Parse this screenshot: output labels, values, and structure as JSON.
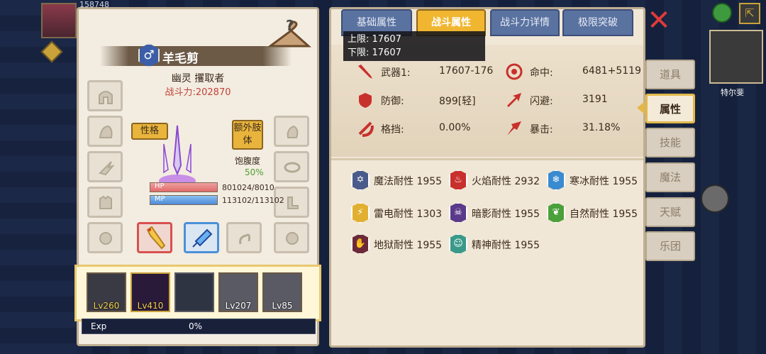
{
  "hud": {
    "top_value": "158748"
  },
  "pet": {
    "gender_symbol": "♂",
    "name": "羊毛剪",
    "title": "幽灵 攫取者",
    "power": "战斗力:202870",
    "tag_personality": "性格",
    "tag_extra_limb": "额外肢体",
    "satiety_label": "饱腹度",
    "satiety_value": "50%",
    "hp_label": "HP",
    "hp_value": "801024/8010",
    "hp_fill": 1.0,
    "mp_label": "MP",
    "mp_value": "113102/113102",
    "mp_fill": 1.0
  },
  "team": [
    {
      "level": "Lv260"
    },
    {
      "level": "Lv410"
    },
    {
      "level": ""
    },
    {
      "level": "Lv207"
    },
    {
      "level": "Lv85"
    }
  ],
  "exp": {
    "label": "Exp",
    "value": "0%",
    "fill": 0
  },
  "tabs": [
    {
      "label": "基础属性"
    },
    {
      "label": "战斗属性"
    },
    {
      "label": "战斗力详情"
    },
    {
      "label": "极限突破"
    }
  ],
  "tooltip": {
    "line1": "上限: 17607",
    "line2": "下限: 17607"
  },
  "stats": {
    "weapon_label": "武器1:",
    "weapon_value": "17607-176",
    "hit_label": "命中:",
    "hit_value": "6481+5119",
    "defense_label": "防御:",
    "defense_value": "899[轻]",
    "dodge_label": "闪避:",
    "dodge_value": "3191",
    "block_label": "格挡:",
    "block_value": "0.00%",
    "crit_label": "暴击:",
    "crit_value": "31.18%"
  },
  "resistances": [
    {
      "label": "魔法耐性 1955",
      "color": "#4a5a8a",
      "symbol": "✡"
    },
    {
      "label": "火焰耐性 2932",
      "color": "#c8302c",
      "symbol": "♨"
    },
    {
      "label": "寒冰耐性 1955",
      "color": "#3a8ad0",
      "symbol": "❄"
    },
    {
      "label": "雷电耐性 1303",
      "color": "#e2b030",
      "symbol": "⚡"
    },
    {
      "label": "暗影耐性 1955",
      "color": "#5a3a8a",
      "symbol": "☠"
    },
    {
      "label": "自然耐性 1955",
      "color": "#4aa03a",
      "symbol": "❦"
    },
    {
      "label": "地狱耐性 1955",
      "color": "#6a2a3a",
      "symbol": "✋"
    },
    {
      "label": "精神耐性 1955",
      "color": "#3a9a8a",
      "symbol": "☺"
    }
  ],
  "side_nav": [
    {
      "label": "道具"
    },
    {
      "label": "属性"
    },
    {
      "label": "技能"
    },
    {
      "label": "魔法"
    },
    {
      "label": "天赋"
    },
    {
      "label": "乐团"
    }
  ],
  "minimap": {
    "label": "特尔斐"
  },
  "colors": {
    "accent": "#f0b630",
    "tab_blue": "#5a72a0",
    "panel": "#f1e7d6"
  }
}
